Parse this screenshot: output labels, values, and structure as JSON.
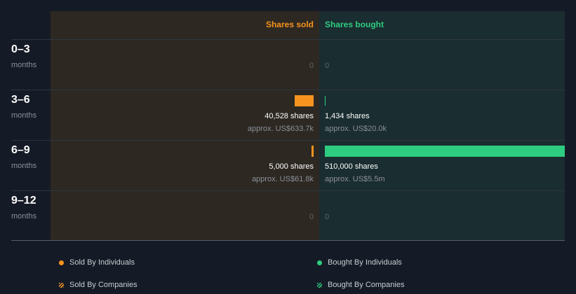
{
  "chart_data": {
    "type": "bar",
    "headers": {
      "sold": "Shares sold",
      "bought": "Shares bought"
    },
    "max_shares": 510000,
    "periods": [
      {
        "label": "0–3",
        "unit": "months",
        "sold": {
          "shares": 0,
          "text": "0"
        },
        "bought": {
          "shares": 0,
          "text": "0"
        }
      },
      {
        "label": "3–6",
        "unit": "months",
        "sold": {
          "shares": 40528,
          "text": "40,528 shares",
          "usd": "approx. US$633.7k"
        },
        "bought": {
          "shares": 1434,
          "text": "1,434 shares",
          "usd": "approx. US$20.0k"
        }
      },
      {
        "label": "6–9",
        "unit": "months",
        "sold": {
          "shares": 5000,
          "text": "5,000 shares",
          "usd": "approx. US$61.8k"
        },
        "bought": {
          "shares": 510000,
          "text": "510,000 shares",
          "usd": "approx. US$5.5m"
        }
      },
      {
        "label": "9–12",
        "unit": "months",
        "sold": {
          "shares": 0,
          "text": "0"
        },
        "bought": {
          "shares": 0,
          "text": "0"
        }
      }
    ],
    "legend": [
      {
        "label": "Sold By Individuals",
        "style": "dot",
        "color": "#f7931e"
      },
      {
        "label": "Bought By Individuals",
        "style": "dot",
        "color": "#2ecc80"
      },
      {
        "label": "Sold By Companies",
        "style": "hatch",
        "color": "#f7931e"
      },
      {
        "label": "Bought By Companies",
        "style": "hatch",
        "color": "#2ecc80"
      }
    ],
    "colors": {
      "sold": "#f7931e",
      "bought": "#2ecc80",
      "sold_panel": "#2d2822",
      "bought_panel": "#1a2d30",
      "background": "#151b26"
    }
  }
}
